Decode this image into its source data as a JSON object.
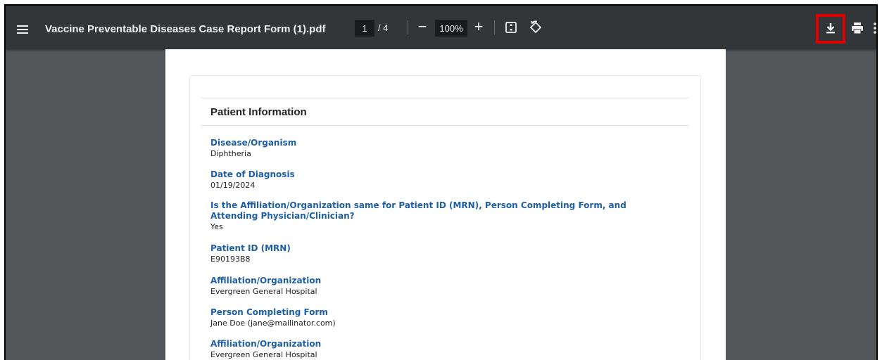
{
  "toolbar": {
    "title": "Vaccine Preventable Diseases Case Report Form (1).pdf",
    "page_current": "1",
    "page_separator": "/ 4",
    "zoom": "100%",
    "zoom_out_symbol": "−",
    "zoom_in_symbol": "+",
    "icons": [
      "menu-icon",
      "fit-page-icon",
      "rotate-icon",
      "download-icon",
      "print-icon",
      "more-vert-icon"
    ],
    "highlight_color": "#e00000"
  },
  "document": {
    "section_title": "Patient Information",
    "fields": [
      {
        "label": "Disease/Organism",
        "value": "Diphtheria"
      },
      {
        "label": "Date of Diagnosis",
        "value": "01/19/2024"
      },
      {
        "label": "Is the Affiliation/Organization same for Patient ID (MRN), Person Completing Form, and Attending Physician/Clinician?",
        "value": "Yes"
      },
      {
        "label": "Patient ID (MRN)",
        "value": "E90193B8"
      },
      {
        "label": "Affiliation/Organization",
        "value": "Evergreen General Hospital"
      },
      {
        "label": "Person Completing Form",
        "value": "Jane Doe (jane@mailinator.com)"
      },
      {
        "label": "Affiliation/Organization",
        "value": "Evergreen General Hospital"
      }
    ]
  },
  "colors": {
    "viewer_bg": "#525659",
    "toolbar_bg": "#323639",
    "label_blue": "#1f5fa5"
  }
}
